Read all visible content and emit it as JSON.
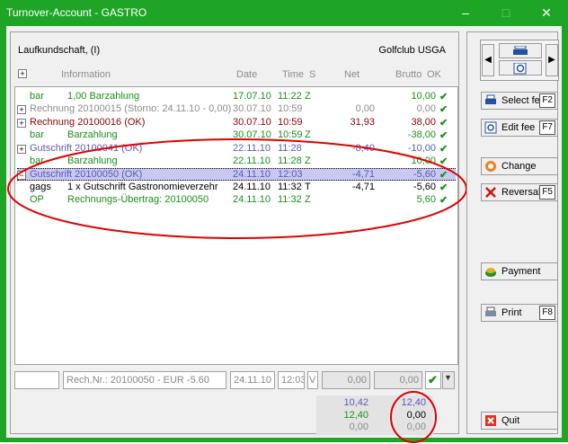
{
  "window": {
    "title": "Turnover-Account - GASTRO",
    "controls": [
      "–",
      "□",
      "✕"
    ]
  },
  "header": {
    "left": "Laufkundschaft, (I)",
    "right": "Golfclub USGA"
  },
  "columns": {
    "information": "Information",
    "date": "Date",
    "time": "Time",
    "s": "S",
    "net": "Net",
    "brutto": "Brutto",
    "ok": "OK"
  },
  "rows": [
    {
      "exp": "",
      "info1": "bar",
      "info2": "1,00 Barzahlung",
      "date": "17.07.10",
      "time": "11:22",
      "s": "Z",
      "net": "",
      "brutto": "10,00",
      "color": "#1a8f1a"
    },
    {
      "exp": "+",
      "info1": "Rechnung 20100015 (Storno: 24.11.10 - 0,00)",
      "info2": "",
      "date": "30.07.10",
      "time": "10:59",
      "s": "",
      "net": "0,00",
      "brutto": "0,00",
      "color": "#8c8c8c"
    },
    {
      "exp": "+",
      "info1": "Rechnung 20100016 (OK)",
      "info2": "",
      "date": "30.07.10",
      "time": "10:59",
      "s": "",
      "net": "31,93",
      "brutto": "38,00",
      "color": "#8b0000"
    },
    {
      "exp": "",
      "info1": "bar",
      "info2": "Barzahlung",
      "date": "30.07.10",
      "time": "10:59",
      "s": "Z",
      "net": "",
      "brutto": "-38,00",
      "color": "#1a8f1a"
    },
    {
      "exp": "+",
      "info1": "Gutschrift 20100041 (OK)",
      "info2": "",
      "date": "22.11.10",
      "time": "11:28",
      "s": "",
      "net": "-8,40",
      "brutto": "-10,00",
      "color": "#5a5ab4"
    },
    {
      "exp": "",
      "info1": "bar",
      "info2": "Barzahlung",
      "date": "22.11.10",
      "time": "11:28",
      "s": "Z",
      "net": "",
      "brutto": "10,00",
      "color": "#1a8f1a"
    },
    {
      "exp": "−",
      "info1": "Gutschrift 20100050 (OK)",
      "info2": "",
      "date": "24.11.10",
      "time": "12:03",
      "s": "",
      "net": "-4,71",
      "brutto": "-5,60",
      "color": "#5a5ab4",
      "selected": true
    },
    {
      "exp": "",
      "info1": "gags",
      "info2": "1 x Gutschrift Gastronomieverzehr",
      "date": "24.11.10",
      "time": "11:32",
      "s": "T",
      "net": "-4,71",
      "brutto": "-5,60",
      "color": "#000000"
    },
    {
      "exp": "",
      "info1": "OP",
      "info2": "Rechnungs-Übertrag: 20100050",
      "date": "24.11.10",
      "time": "11:32",
      "s": "Z",
      "net": "",
      "brutto": "5,60",
      "color": "#1a8f1a"
    }
  ],
  "edit_fields": {
    "field1": "",
    "rech": "Rech.Nr.: 20100050 - EUR -5.60",
    "date": "24.11.10",
    "time": "12:03",
    "v": "V",
    "net": "0,00",
    "brutto": "0,00"
  },
  "summary": {
    "line1_net": "10,42",
    "line1_brutto": "12,40",
    "line2_net": "12,40",
    "line2_brutto": "0,00",
    "line3_net": "0,00",
    "line3_brutto": "0,00"
  },
  "buttons": {
    "select_fee": "Select fee",
    "select_fee_key": "F2",
    "edit_fee": "Edit fee",
    "edit_fee_key": "F7",
    "change": "Change",
    "reversal": "Reversal",
    "reversal_key": "F5",
    "payment": "Payment",
    "print": "Print",
    "print_key": "F8",
    "quit": "Quit"
  },
  "colors": {
    "titlebar": "#1fa526",
    "annotation": "#e00000"
  }
}
